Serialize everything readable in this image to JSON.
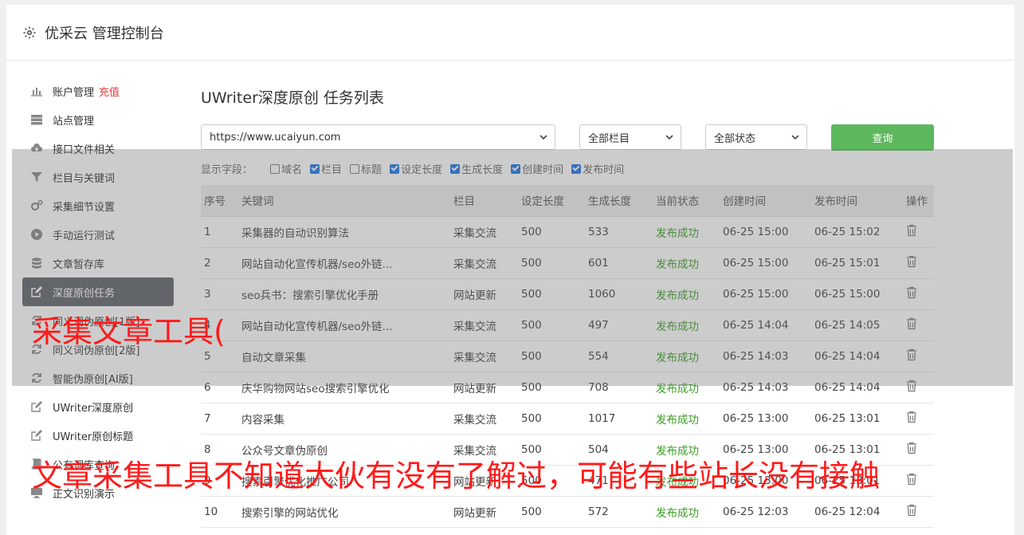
{
  "header": {
    "title": "优采云 管理控制台"
  },
  "sidebar": {
    "items": [
      {
        "label": "账户管理",
        "badge": "充值",
        "icon": "bar-chart-icon"
      },
      {
        "label": "站点管理",
        "icon": "server-icon"
      },
      {
        "label": "接口文件相关",
        "icon": "cloud-download-icon"
      },
      {
        "label": "栏目与关键词",
        "icon": "filter-icon"
      },
      {
        "label": "采集细节设置",
        "icon": "gears-icon"
      },
      {
        "label": "手动运行测试",
        "icon": "play-icon"
      },
      {
        "label": "文章暂存库",
        "icon": "database-icon"
      },
      {
        "label": "深度原创任务",
        "icon": "edit-icon"
      },
      {
        "label": "同义词伪原创[1版]",
        "icon": "refresh-icon"
      },
      {
        "label": "同义词伪原创[2版]",
        "icon": "refresh-icon"
      },
      {
        "label": "智能伪原创[AI版]",
        "icon": "refresh-icon"
      },
      {
        "label": "UWriter深度原创",
        "icon": "edit-icon"
      },
      {
        "label": "UWriter原创标题",
        "icon": "edit-icon"
      },
      {
        "label": "公有词库查询",
        "icon": "book-icon"
      },
      {
        "label": "正文识别演示",
        "icon": "monitor-icon"
      }
    ]
  },
  "page": {
    "title": "UWriter深度原创 任务列表"
  },
  "filters": {
    "site": "https://www.ucaiyun.com",
    "column": "全部栏目",
    "status": "全部状态",
    "query_label": "查询"
  },
  "fields": {
    "label": "显示字段：",
    "options": [
      {
        "label": "域名",
        "checked": false
      },
      {
        "label": "栏目",
        "checked": true
      },
      {
        "label": "标题",
        "checked": false
      },
      {
        "label": "设定长度",
        "checked": true
      },
      {
        "label": "生成长度",
        "checked": true
      },
      {
        "label": "创建时间",
        "checked": true
      },
      {
        "label": "发布时间",
        "checked": true
      }
    ]
  },
  "table": {
    "headers": [
      "序号",
      "关键词",
      "栏目",
      "设定长度",
      "生成长度",
      "当前状态",
      "创建时间",
      "发布时间",
      "操作"
    ],
    "rows": [
      [
        "1",
        "采集器的自动识别算法",
        "采集交流",
        "500",
        "533",
        "发布成功",
        "06-25 15:00",
        "06-25 15:02"
      ],
      [
        "2",
        "网站自动化宣传机器/seo外链...",
        "采集交流",
        "500",
        "601",
        "发布成功",
        "06-25 15:00",
        "06-25 15:01"
      ],
      [
        "3",
        "seo兵书：搜索引擎优化手册",
        "网站更新",
        "500",
        "1060",
        "发布成功",
        "06-25 15:00",
        "06-25 15:00"
      ],
      [
        "4",
        "网站自动化宣传机器/seo外链...",
        "采集交流",
        "500",
        "497",
        "发布成功",
        "06-25 14:04",
        "06-25 14:05"
      ],
      [
        "5",
        "自动文章采集",
        "采集交流",
        "500",
        "554",
        "发布成功",
        "06-25 14:03",
        "06-25 14:04"
      ],
      [
        "6",
        "庆华购物网站seo搜索引擎优化",
        "网站更新",
        "500",
        "708",
        "发布成功",
        "06-25 14:03",
        "06-25 14:04"
      ],
      [
        "7",
        "内容采集",
        "采集交流",
        "500",
        "1017",
        "发布成功",
        "06-25 13:00",
        "06-25 13:01"
      ],
      [
        "8",
        "公众号文章伪原创",
        "采集交流",
        "500",
        "504",
        "发布成功",
        "06-25 13:00",
        "06-25 13:01"
      ],
      [
        "9",
        "搜索引擎优化推广公司",
        "网站更新",
        "500",
        "471",
        "发布成功",
        "06-25 13:00",
        "06-25 13:01"
      ],
      [
        "10",
        "搜索引擎的网站优化",
        "网站更新",
        "500",
        "572",
        "发布成功",
        "06-25 12:03",
        "06-25 12:04"
      ]
    ]
  },
  "watermark": {
    "line1": "采集文章工具(",
    "line2": "文章采集工具不知道大伙有没有了解过，可能有些站长没有接触"
  },
  "colors": {
    "accent": "#5cb85c",
    "status_ok": "#3a9d23",
    "sidebar_active": "#5c636a",
    "watermark": "#ff1a1a",
    "badge": "#e4393c"
  }
}
